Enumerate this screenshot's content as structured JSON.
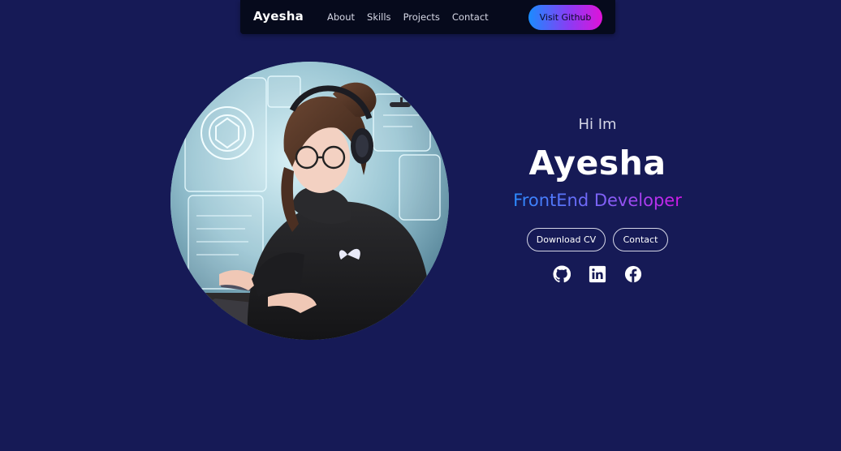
{
  "navbar": {
    "brand": "Ayesha",
    "links": [
      "About",
      "Skills",
      "Projects",
      "Contact"
    ],
    "cta_label": "Visit Github"
  },
  "hero": {
    "greeting": "Hi Im",
    "name": "Ayesha",
    "role": "FrontEnd Developer",
    "buttons": {
      "download_cv": "Download CV",
      "contact": "Contact"
    },
    "socials": [
      "github-icon",
      "linkedin-icon",
      "facebook-icon"
    ]
  },
  "colors": {
    "background": "#161a56",
    "navbar": "#060a1c",
    "gradient_start": "#1a8cff",
    "gradient_end": "#e012d8",
    "text_muted": "#d4d6e6"
  }
}
